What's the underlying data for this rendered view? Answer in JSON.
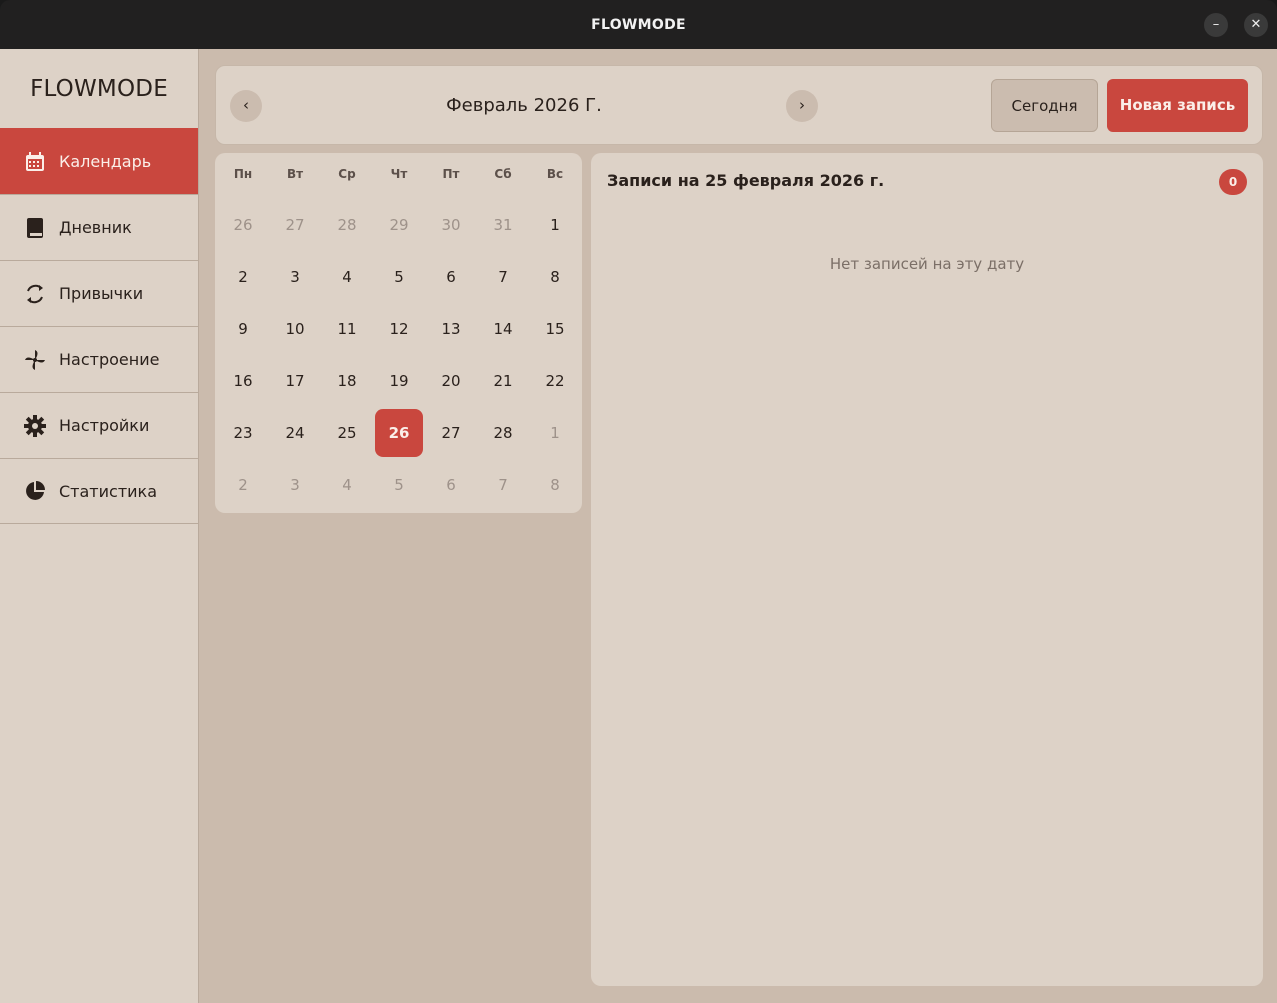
{
  "window": {
    "title": "FLOWMODE",
    "minimize": "–",
    "close": "✕"
  },
  "sidebar": {
    "brand": "FLOWMODE",
    "items": [
      {
        "label": "Календарь",
        "icon": "calendar-icon",
        "active": true
      },
      {
        "label": "Дневник",
        "icon": "book-icon",
        "active": false
      },
      {
        "label": "Привычки",
        "icon": "refresh-icon",
        "active": false
      },
      {
        "label": "Настроение",
        "icon": "pinwheel-icon",
        "active": false
      },
      {
        "label": "Настройки",
        "icon": "gear-icon",
        "active": false
      },
      {
        "label": "Статистика",
        "icon": "pie-chart-icon",
        "active": false
      }
    ]
  },
  "header": {
    "prev": "‹",
    "next": "›",
    "month": "Февраль 2026 Г.",
    "today_label": "Сегодня",
    "new_entry_label": "Новая запись"
  },
  "calendar": {
    "weekdays": [
      "Пн",
      "Вт",
      "Ср",
      "Чт",
      "Пт",
      "Сб",
      "Вс"
    ],
    "weeks": [
      [
        {
          "d": "26",
          "m": true
        },
        {
          "d": "27",
          "m": true
        },
        {
          "d": "28",
          "m": true
        },
        {
          "d": "29",
          "m": true
        },
        {
          "d": "30",
          "m": true
        },
        {
          "d": "31",
          "m": true
        },
        {
          "d": "1",
          "m": false
        }
      ],
      [
        {
          "d": "2",
          "m": false
        },
        {
          "d": "3",
          "m": false
        },
        {
          "d": "4",
          "m": false
        },
        {
          "d": "5",
          "m": false
        },
        {
          "d": "6",
          "m": false
        },
        {
          "d": "7",
          "m": false
        },
        {
          "d": "8",
          "m": false
        }
      ],
      [
        {
          "d": "9",
          "m": false
        },
        {
          "d": "10",
          "m": false
        },
        {
          "d": "11",
          "m": false
        },
        {
          "d": "12",
          "m": false
        },
        {
          "d": "13",
          "m": false
        },
        {
          "d": "14",
          "m": false
        },
        {
          "d": "15",
          "m": false
        }
      ],
      [
        {
          "d": "16",
          "m": false
        },
        {
          "d": "17",
          "m": false
        },
        {
          "d": "18",
          "m": false
        },
        {
          "d": "19",
          "m": false
        },
        {
          "d": "20",
          "m": false
        },
        {
          "d": "21",
          "m": false
        },
        {
          "d": "22",
          "m": false
        }
      ],
      [
        {
          "d": "23",
          "m": false
        },
        {
          "d": "24",
          "m": false
        },
        {
          "d": "25",
          "m": false
        },
        {
          "d": "26",
          "m": false,
          "sel": true
        },
        {
          "d": "27",
          "m": false
        },
        {
          "d": "28",
          "m": false
        },
        {
          "d": "1",
          "m": true
        }
      ],
      [
        {
          "d": "2",
          "m": true
        },
        {
          "d": "3",
          "m": true
        },
        {
          "d": "4",
          "m": true
        },
        {
          "d": "5",
          "m": true
        },
        {
          "d": "6",
          "m": true
        },
        {
          "d": "7",
          "m": true
        },
        {
          "d": "8",
          "m": true
        }
      ]
    ]
  },
  "entries": {
    "title": "Записи на 25 февраля 2026 г.",
    "count": "0",
    "empty_text": "Нет записей на эту дату"
  },
  "colors": {
    "accent": "#c9473e",
    "panel": "#ddd2c7",
    "background": "#cbbbad"
  }
}
